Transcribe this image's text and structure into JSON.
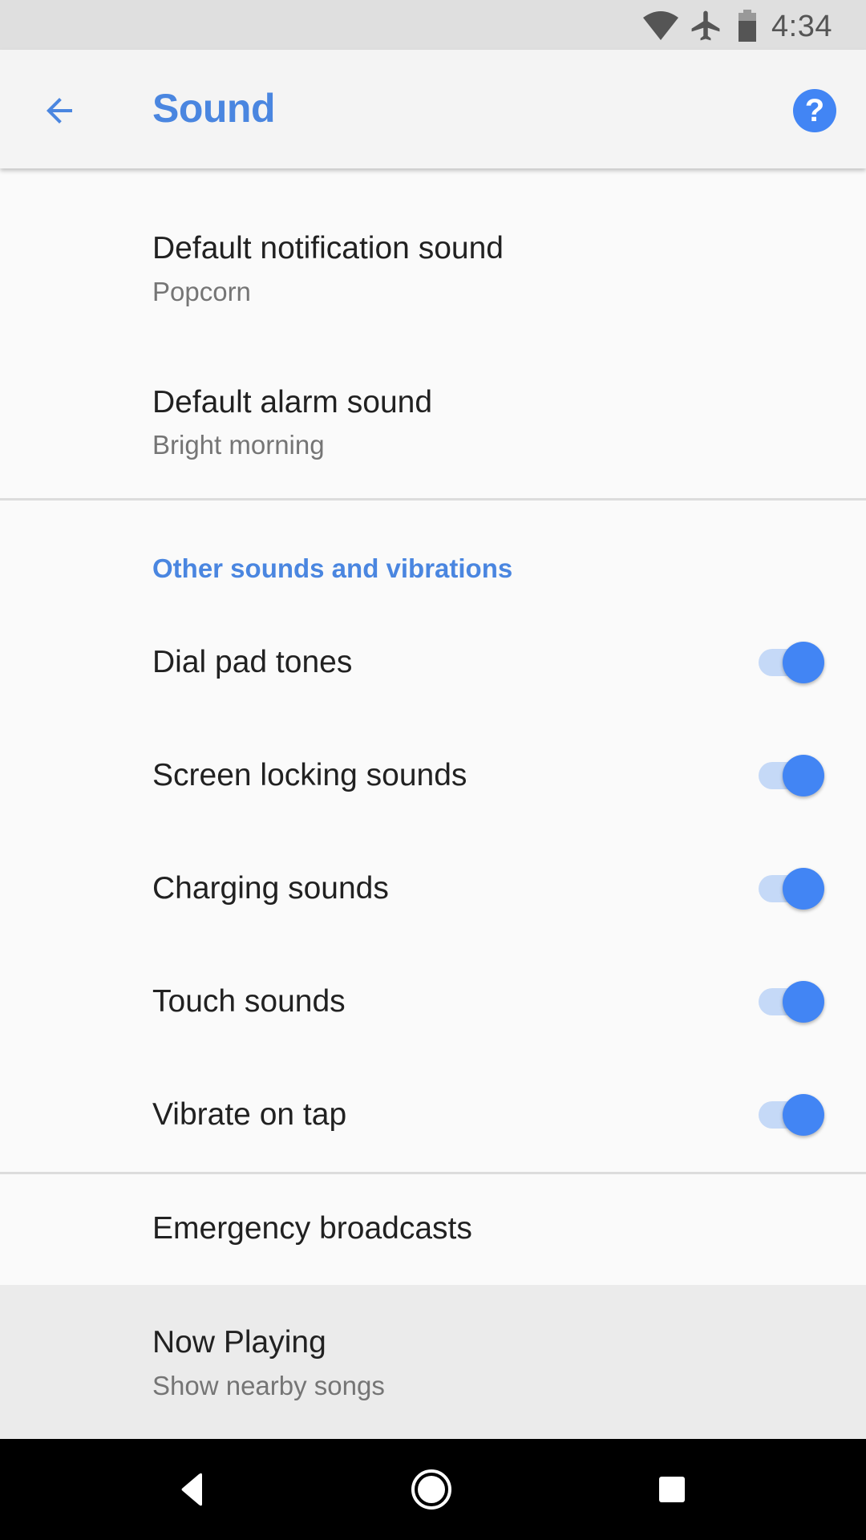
{
  "status_bar": {
    "time": "4:34",
    "icons": [
      "wifi-icon",
      "airplane-mode-icon",
      "battery-icon"
    ]
  },
  "app_bar": {
    "title": "Sound",
    "back_icon": "arrow-left-icon",
    "help_icon": "help-circle-icon",
    "help_glyph": "?"
  },
  "preferences": [
    {
      "title": "Default notification sound",
      "summary": "Popcorn"
    },
    {
      "title": "Default alarm sound",
      "summary": "Bright morning"
    }
  ],
  "section": {
    "header": "Other sounds and vibrations",
    "toggles": [
      {
        "label": "Dial pad tones",
        "checked": true
      },
      {
        "label": "Screen locking sounds",
        "checked": true
      },
      {
        "label": "Charging sounds",
        "checked": true
      },
      {
        "label": "Touch sounds",
        "checked": true
      },
      {
        "label": "Vibrate on tap",
        "checked": true
      }
    ]
  },
  "extra_items": [
    {
      "title": "Emergency broadcasts"
    },
    {
      "title": "Now Playing",
      "summary": "Show nearby songs"
    }
  ],
  "nav_bar": {
    "buttons": [
      "back-icon",
      "home-icon",
      "recents-icon"
    ]
  },
  "colors": {
    "accent": "#4285f4",
    "title_blue": "#4a86e0",
    "track_on": "#c5d9f7",
    "text_primary": "#212121",
    "text_secondary": "#757575"
  }
}
